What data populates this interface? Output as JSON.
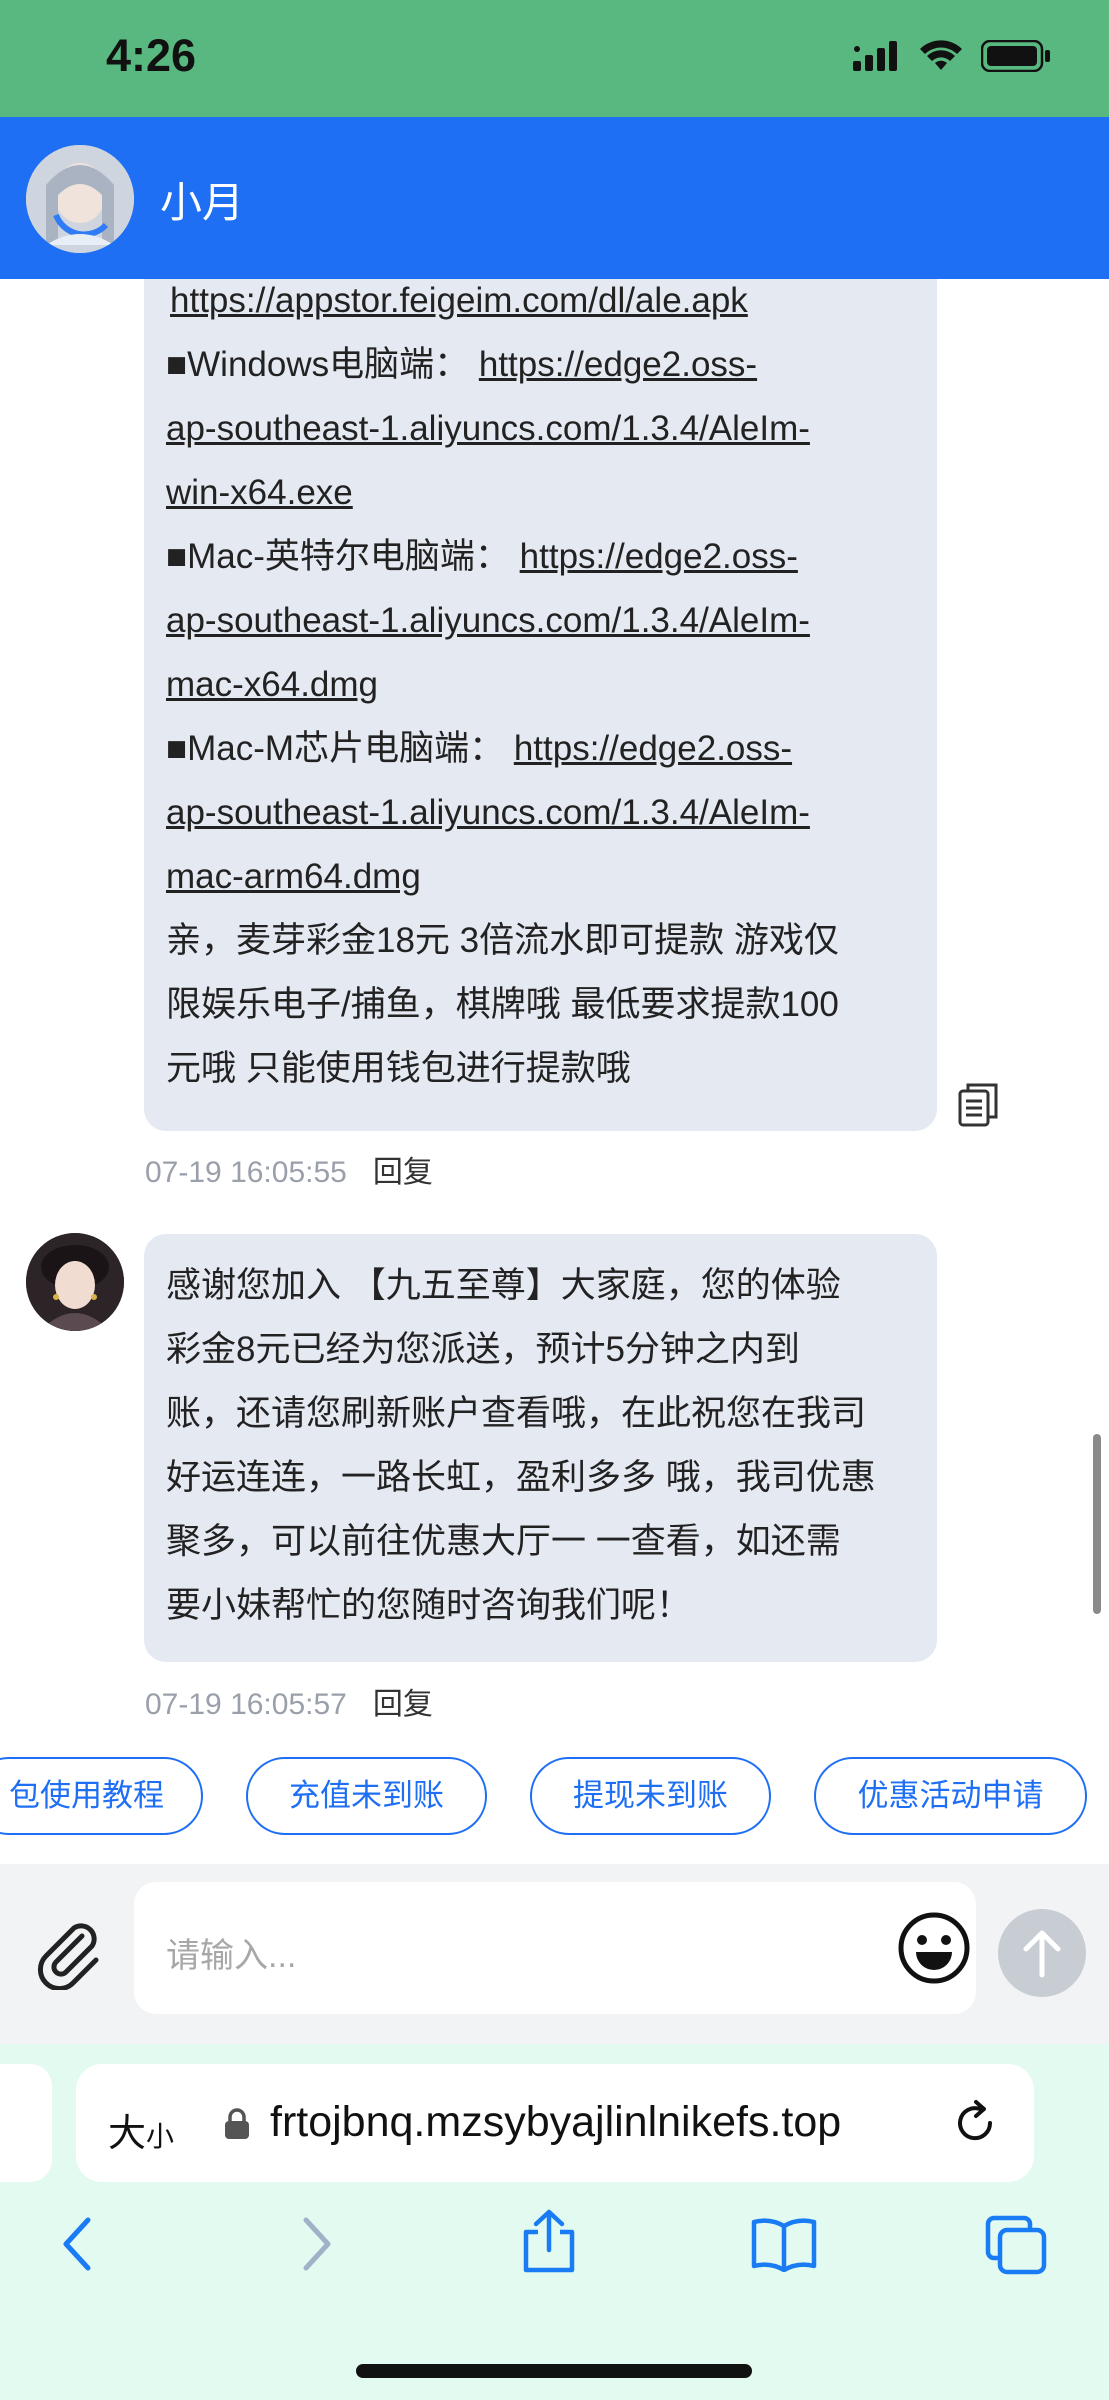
{
  "status": {
    "time": "4:26"
  },
  "header": {
    "name": "小月"
  },
  "messages": [
    {
      "lines": [
        {
          "text": "",
          "link": "https://appstor.feigeim.com/dl/ale.apk"
        },
        {
          "text": "■Windows电脑端：",
          "link": "https://edge2.oss-"
        },
        {
          "text": "",
          "link": "ap-southeast-1.aliyuncs.com/1.3.4/AleIm-"
        },
        {
          "text": "",
          "link": "win-x64.exe"
        },
        {
          "text": "■Mac-英特尔电脑端：",
          "link": "https://edge2.oss-"
        },
        {
          "text": "",
          "link": "ap-southeast-1.aliyuncs.com/1.3.4/AleIm-"
        },
        {
          "text": "",
          "link": "mac-x64.dmg"
        },
        {
          "text": "■Mac-M芯片电脑端：",
          "link": "https://edge2.oss-"
        },
        {
          "text": "",
          "link": "ap-southeast-1.aliyuncs.com/1.3.4/AleIm-"
        },
        {
          "text": "",
          "link": "mac-arm64.dmg"
        },
        {
          "text": "亲，麦芽彩金18元 3倍流水即可提款 游戏仅",
          "link": ""
        },
        {
          "text": "限娱乐电子/捕鱼，棋牌哦 最低要求提款100",
          "link": ""
        },
        {
          "text": "元哦 只能使用钱包进行提款哦",
          "link": ""
        }
      ],
      "time": "07-19 16:05:55",
      "reply": "回复"
    },
    {
      "lines": [
        {
          "text": "感谢您加入 【九五至尊】大家庭，您的体验",
          "link": ""
        },
        {
          "text": "彩金8元已经为您派送，预计5分钟之内到",
          "link": ""
        },
        {
          "text": "账，还请您刷新账户查看哦，在此祝您在我司",
          "link": ""
        },
        {
          "text": "好运连连，一路长虹，盈利多多 哦，我司优惠",
          "link": ""
        },
        {
          "text": "聚多，可以前往优惠大厅一 一查看，如还需",
          "link": ""
        },
        {
          "text": "要小妹帮忙的您随时咨询我们呢！",
          "link": ""
        }
      ],
      "time": "07-19 16:05:57",
      "reply": "回复"
    }
  ],
  "quick_replies": [
    "包使用教程",
    "充值未到账",
    "提现未到账",
    "优惠活动申请"
  ],
  "input": {
    "placeholder": "请输入..."
  },
  "browser": {
    "aa_big": "大",
    "aa_small": "小",
    "url": "frtojbnq.mzsybyajlinlnikefs.top"
  }
}
